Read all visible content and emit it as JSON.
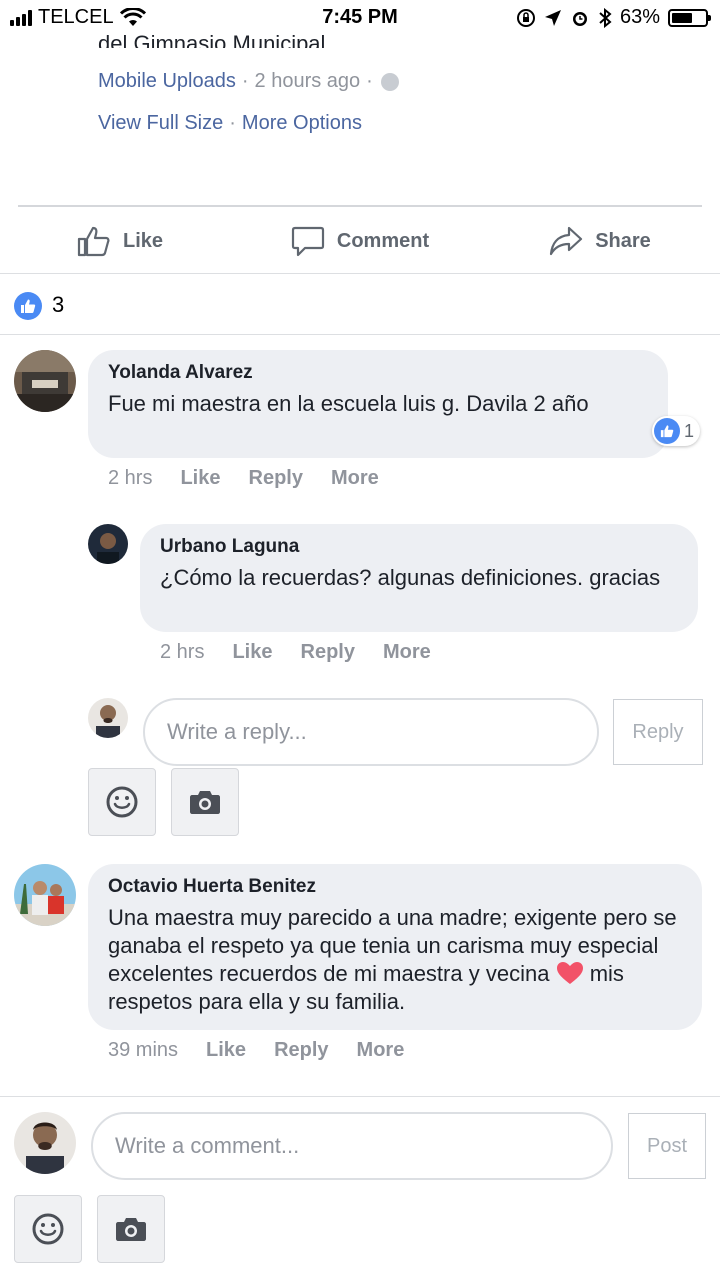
{
  "status_bar": {
    "carrier": "TELCEL",
    "time": "7:45 PM",
    "battery": "63%",
    "battery_level": 0.63
  },
  "post": {
    "text_fragment": "del Gimnasio Municipal.",
    "source": "Mobile Uploads",
    "time_ago": "2 hours ago",
    "links": [
      "View Full Size",
      "More Options"
    ]
  },
  "actions": {
    "like": "Like",
    "comment": "Comment",
    "share": "Share"
  },
  "reactions": {
    "count": "3"
  },
  "comments": [
    {
      "name": "Yolanda Alvarez",
      "text": "Fue mi maestra en la escuela luis g. Davila 2 año",
      "time": "2 hrs",
      "like": "Like",
      "reply": "Reply",
      "more": "More",
      "reaction_count": "1"
    },
    {
      "name": "Urbano Laguna",
      "text": "¿Cómo la recuerdas? algunas definiciones. gracias",
      "time": "2 hrs",
      "like": "Like",
      "reply": "Reply",
      "more": "More"
    },
    {
      "name": "Octavio Huerta Benitez",
      "text_before": "Una maestra muy parecido a una madre; exigente pero se ganaba el respeto ya que tenia un carisma muy especial excelentes recuerdos de mi maestra y vecina",
      "text_after": "mis respetos para ella y su familia.",
      "time": "39 mins",
      "like": "Like",
      "reply": "Reply",
      "more": "More"
    }
  ],
  "reply_box": {
    "placeholder": "Write a reply...",
    "button": "Reply"
  },
  "comment_box": {
    "placeholder": "Write a comment...",
    "button": "Post"
  },
  "colors": {
    "link": "#4b66a0",
    "like_blue": "#4a8af4",
    "bubble": "#edeff3",
    "heart": "#f25268"
  }
}
